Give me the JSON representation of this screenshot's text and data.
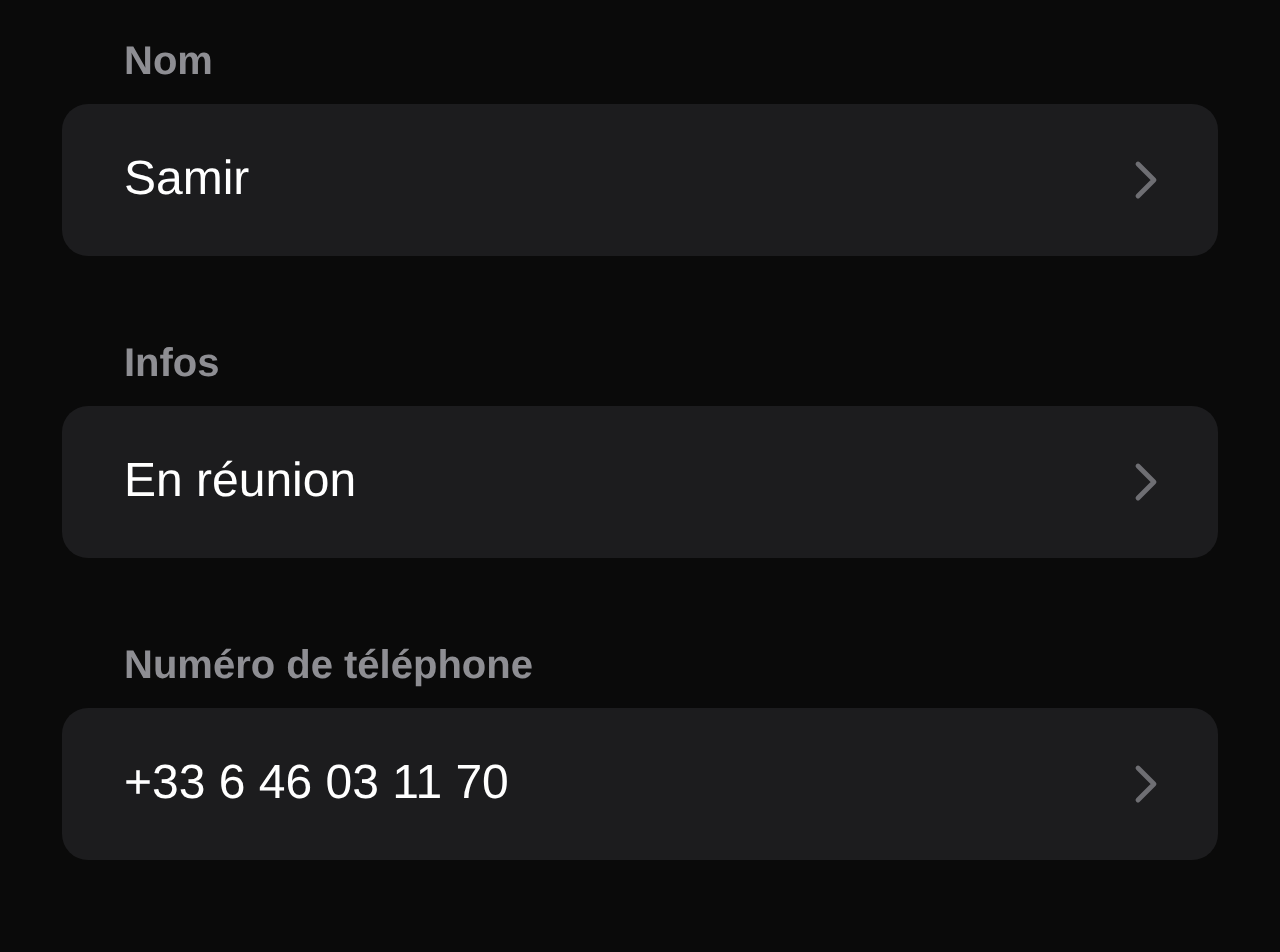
{
  "sections": [
    {
      "label": "Nom",
      "value": "Samir"
    },
    {
      "label": "Infos",
      "value": "En réunion"
    },
    {
      "label": "Numéro de téléphone",
      "value": "+33 6 46 03 11 70"
    }
  ]
}
